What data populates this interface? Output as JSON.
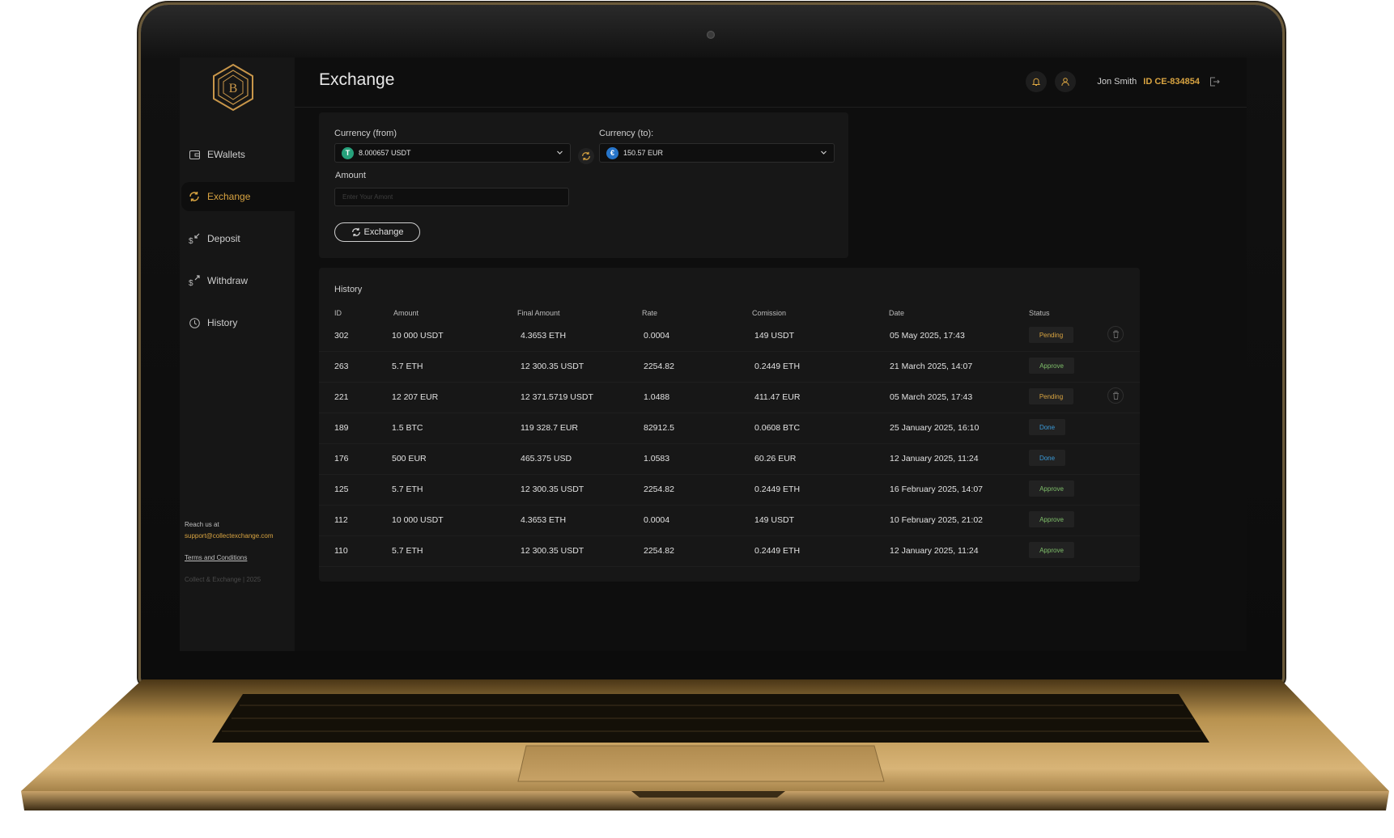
{
  "app": {
    "page_title": "Exchange",
    "user_name": "Jon Smith",
    "user_id": "ID CE-834854",
    "accent_color": "#d9a441"
  },
  "sidebar": {
    "items": [
      {
        "label": "EWallets",
        "icon": "wallet-icon",
        "active": false
      },
      {
        "label": "Exchange",
        "icon": "exchange-icon",
        "active": true
      },
      {
        "label": "Deposit",
        "icon": "deposit-icon",
        "active": false
      },
      {
        "label": "Withdraw",
        "icon": "withdraw-icon",
        "active": false
      },
      {
        "label": "History",
        "icon": "clock-icon",
        "active": false
      }
    ],
    "reach_us": "Reach us at",
    "email": "support@collectexchange.com",
    "terms": "Terms and Conditions",
    "copyright": "Collect & Exchange | 2025"
  },
  "exchange": {
    "from_label": "Currency (from)",
    "from_value": "8.000657 USDT",
    "from_coin_symbol": "T",
    "from_coin_color": "#26a17b",
    "to_label": "Currency (to):",
    "to_value": "150.57 EUR",
    "to_coin_symbol": "€",
    "to_coin_color": "#2775ca",
    "amount_label": "Amount",
    "amount_placeholder": "Enter Your Amont",
    "button_label": "Exchange"
  },
  "history": {
    "title": "History",
    "columns": [
      "ID",
      "Amount",
      "Final Amount",
      "Rate",
      "Comission",
      "Date",
      "Status"
    ],
    "status_colors": {
      "Pending": "#d9a441",
      "Approve": "#7fbf6a",
      "Done": "#3a9ad9"
    },
    "rows": [
      {
        "id": "302",
        "amount": "10 000 USDT",
        "final": "4.3653 ETH",
        "rate": "0.0004",
        "commission": "149 USDT",
        "date": "05 May 2025, 17:43",
        "status": "Pending",
        "deletable": true
      },
      {
        "id": "263",
        "amount": "5.7 ETH",
        "final": "12 300.35 USDT",
        "rate": "2254.82",
        "commission": "0.2449 ETH",
        "date": "21 March 2025, 14:07",
        "status": "Approve",
        "deletable": false
      },
      {
        "id": "221",
        "amount": "12 207 EUR",
        "final": "12 371.5719 USDT",
        "rate": "1.0488",
        "commission": "411.47 EUR",
        "date": "05 March 2025, 17:43",
        "status": "Pending",
        "deletable": true
      },
      {
        "id": "189",
        "amount": "1.5 BTC",
        "final": "119 328.7 EUR",
        "rate": "82912.5",
        "commission": "0.0608 BTC",
        "date": "25 January 2025, 16:10",
        "status": "Done",
        "deletable": false
      },
      {
        "id": "176",
        "amount": "500 EUR",
        "final": "465.375 USD",
        "rate": "1.0583",
        "commission": "60.26 EUR",
        "date": "12 January 2025, 11:24",
        "status": "Done",
        "deletable": false
      },
      {
        "id": "125",
        "amount": "5.7 ETH",
        "final": "12 300.35 USDT",
        "rate": "2254.82",
        "commission": "0.2449 ETH",
        "date": "16 February 2025, 14:07",
        "status": "Approve",
        "deletable": false
      },
      {
        "id": "112",
        "amount": "10 000 USDT",
        "final": "4.3653 ETH",
        "rate": "0.0004",
        "commission": "149 USDT",
        "date": "10 February 2025, 21:02",
        "status": "Approve",
        "deletable": false
      },
      {
        "id": "110",
        "amount": "5.7 ETH",
        "final": "12 300.35 USDT",
        "rate": "2254.82",
        "commission": "0.2449 ETH",
        "date": "12 January 2025, 11:24",
        "status": "Approve",
        "deletable": false
      }
    ]
  }
}
